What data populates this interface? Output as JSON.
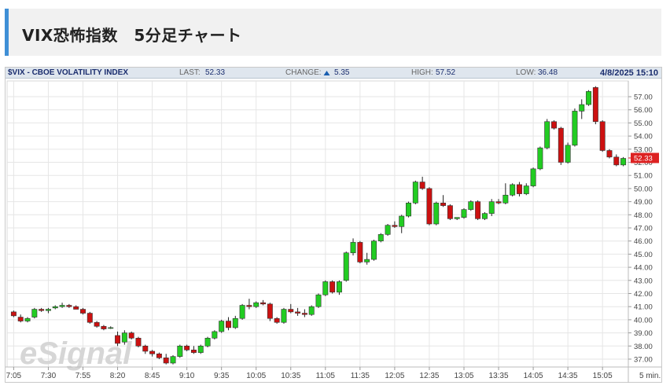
{
  "header": {
    "title": "VIX恐怖指数　5分足チャート"
  },
  "info": {
    "symbol": "$VIX - CBOE VOLATILITY INDEX",
    "last_label": "LAST:",
    "last_value": "52.33",
    "change_label": "CHANGE:",
    "change_value": "5.35",
    "high_label": "HIGH:",
    "high_value": "57.52",
    "low_label": "LOW:",
    "low_value": "36.48",
    "datetime": "4/8/2025 15:10"
  },
  "watermark": "eSignal",
  "colors": {
    "up": "#22cc22",
    "down": "#cc1111",
    "last_price_bg": "#dd2222",
    "up_arrow": "#1a5fb0"
  },
  "chart_data": {
    "type": "candlestick",
    "title": "",
    "interval_label": "5 min.",
    "ylim": [
      36.4,
      58.2
    ],
    "y_ticks": [
      "37.00",
      "38.00",
      "39.00",
      "40.00",
      "41.00",
      "42.00",
      "43.00",
      "44.00",
      "45.00",
      "46.00",
      "47.00",
      "48.00",
      "49.00",
      "50.00",
      "51.00",
      "52.00",
      "53.00",
      "54.00",
      "55.00",
      "56.00",
      "57.00"
    ],
    "x_ticks": [
      "7:05",
      "7:30",
      "7:55",
      "8:20",
      "8:45",
      "9:10",
      "9:35",
      "10:05",
      "10:35",
      "11:05",
      "11:35",
      "12:05",
      "12:35",
      "13:05",
      "13:35",
      "14:05",
      "14:35",
      "15:05"
    ],
    "last_price": "52.33",
    "ohlc": [
      [
        40.6,
        40.7,
        40.2,
        40.3
      ],
      [
        40.2,
        40.4,
        39.8,
        39.9
      ],
      [
        39.9,
        40.2,
        39.8,
        40.1
      ],
      [
        40.2,
        40.9,
        40.1,
        40.8
      ],
      [
        40.8,
        40.9,
        40.6,
        40.7
      ],
      [
        40.7,
        40.9,
        40.5,
        40.8
      ],
      [
        40.9,
        41.1,
        40.8,
        41.0
      ],
      [
        41.0,
        41.3,
        40.9,
        41.1
      ],
      [
        41.1,
        41.2,
        40.9,
        41.0
      ],
      [
        41.0,
        41.1,
        40.8,
        40.8
      ],
      [
        40.8,
        40.9,
        40.4,
        40.5
      ],
      [
        40.5,
        40.6,
        39.7,
        39.8
      ],
      [
        39.8,
        39.9,
        39.4,
        39.5
      ],
      [
        39.5,
        39.6,
        39.2,
        39.3
      ],
      [
        39.4,
        39.5,
        39.3,
        39.4
      ],
      [
        38.8,
        39.1,
        38.0,
        38.2
      ],
      [
        38.3,
        39.2,
        38.1,
        39.0
      ],
      [
        39.0,
        39.1,
        38.5,
        38.6
      ],
      [
        38.6,
        38.7,
        37.9,
        38.0
      ],
      [
        38.0,
        38.1,
        37.4,
        37.6
      ],
      [
        37.6,
        37.7,
        37.2,
        37.4
      ],
      [
        37.4,
        37.5,
        37.0,
        37.1
      ],
      [
        37.1,
        37.4,
        36.6,
        36.7
      ],
      [
        36.7,
        37.3,
        36.6,
        37.2
      ],
      [
        37.2,
        38.1,
        37.1,
        38.0
      ],
      [
        38.0,
        38.1,
        37.6,
        37.7
      ],
      [
        37.7,
        38.0,
        37.4,
        37.5
      ],
      [
        37.5,
        38.1,
        37.4,
        38.0
      ],
      [
        38.0,
        38.7,
        37.9,
        38.6
      ],
      [
        38.6,
        39.2,
        38.5,
        39.1
      ],
      [
        39.1,
        40.0,
        39.0,
        39.9
      ],
      [
        39.9,
        40.2,
        39.2,
        39.4
      ],
      [
        39.4,
        40.3,
        39.3,
        40.1
      ],
      [
        40.1,
        41.2,
        40.0,
        41.1
      ],
      [
        41.1,
        41.6,
        40.8,
        41.0
      ],
      [
        41.0,
        41.4,
        40.9,
        41.3
      ],
      [
        41.3,
        41.5,
        41.1,
        41.2
      ],
      [
        41.2,
        41.3,
        39.9,
        40.1
      ],
      [
        40.1,
        40.2,
        39.7,
        39.8
      ],
      [
        39.8,
        40.9,
        39.7,
        40.8
      ],
      [
        40.8,
        41.2,
        40.5,
        40.6
      ],
      [
        40.6,
        40.9,
        40.3,
        40.5
      ],
      [
        40.5,
        40.8,
        40.2,
        40.4
      ],
      [
        40.4,
        41.1,
        40.3,
        41.0
      ],
      [
        41.0,
        42.0,
        40.9,
        41.9
      ],
      [
        41.9,
        43.0,
        41.8,
        42.9
      ],
      [
        42.9,
        43.0,
        42.0,
        42.1
      ],
      [
        42.1,
        43.0,
        41.9,
        42.9
      ],
      [
        43.0,
        45.2,
        42.9,
        45.1
      ],
      [
        45.1,
        46.2,
        44.9,
        45.9
      ],
      [
        45.9,
        46.0,
        44.3,
        44.4
      ],
      [
        44.4,
        45.1,
        44.2,
        44.6
      ],
      [
        44.6,
        46.1,
        44.5,
        46.0
      ],
      [
        46.0,
        46.6,
        45.9,
        46.5
      ],
      [
        46.5,
        47.3,
        46.4,
        47.2
      ],
      [
        47.2,
        47.5,
        47.0,
        47.1
      ],
      [
        47.1,
        48.0,
        46.6,
        47.9
      ],
      [
        47.9,
        49.0,
        47.8,
        48.9
      ],
      [
        48.9,
        50.6,
        48.8,
        50.5
      ],
      [
        50.5,
        50.9,
        49.9,
        50.0
      ],
      [
        50.0,
        50.1,
        47.2,
        47.3
      ],
      [
        47.3,
        49.0,
        47.2,
        48.9
      ],
      [
        48.9,
        49.5,
        48.6,
        48.7
      ],
      [
        48.7,
        48.8,
        47.6,
        47.7
      ],
      [
        47.7,
        47.8,
        47.6,
        47.8
      ],
      [
        47.8,
        48.5,
        47.7,
        48.4
      ],
      [
        48.4,
        49.1,
        48.3,
        49.0
      ],
      [
        49.0,
        49.1,
        47.6,
        47.7
      ],
      [
        47.7,
        48.2,
        47.6,
        48.1
      ],
      [
        48.1,
        49.2,
        47.9,
        49.0
      ],
      [
        49.0,
        49.2,
        48.8,
        48.9
      ],
      [
        48.9,
        50.4,
        48.8,
        49.5
      ],
      [
        49.5,
        50.4,
        49.4,
        50.3
      ],
      [
        50.3,
        50.5,
        49.4,
        49.6
      ],
      [
        49.6,
        50.4,
        49.5,
        50.2
      ],
      [
        50.2,
        51.6,
        50.1,
        51.5
      ],
      [
        51.5,
        53.2,
        51.4,
        53.1
      ],
      [
        53.1,
        55.3,
        53.0,
        55.1
      ],
      [
        55.1,
        55.2,
        54.5,
        54.6
      ],
      [
        54.6,
        54.7,
        51.8,
        52.0
      ],
      [
        52.0,
        53.5,
        51.9,
        53.3
      ],
      [
        53.3,
        56.1,
        53.2,
        55.9
      ],
      [
        55.9,
        56.8,
        55.3,
        56.4
      ],
      [
        56.4,
        57.5,
        56.3,
        57.4
      ],
      [
        57.7,
        57.8,
        54.9,
        55.1
      ],
      [
        55.1,
        55.2,
        52.8,
        52.9
      ],
      [
        52.9,
        53.0,
        52.3,
        52.4
      ],
      [
        52.4,
        52.6,
        51.7,
        51.8
      ],
      [
        51.8,
        52.4,
        51.7,
        52.3
      ]
    ]
  }
}
